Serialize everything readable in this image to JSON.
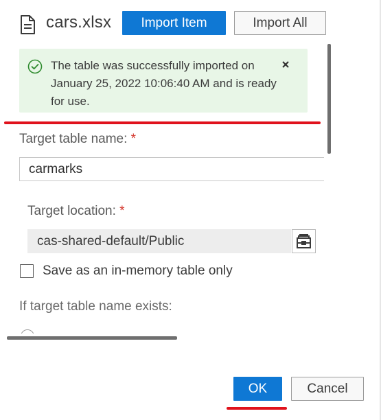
{
  "header": {
    "file_name": "cars.xlsx",
    "import_item_label": "Import Item",
    "import_all_label": "Import All"
  },
  "banner": {
    "message": "The table was successfully imported on January 25, 2022 10:06:40 AM and is ready for use.",
    "status_color": "#2e8b2e",
    "background": "#e8f6e7"
  },
  "form": {
    "target_table_label": "Target table name:",
    "target_table_value": "carmarks",
    "target_location_label": "Target location:",
    "target_location_value": "cas-shared-default/Public",
    "required_mark": "*",
    "in_memory_label": "Save as an in-memory table only",
    "in_memory_checked": false,
    "if_exists_label": "If target table name exists:"
  },
  "footer": {
    "ok_label": "OK",
    "cancel_label": "Cancel"
  },
  "colors": {
    "primary": "#0f78d4",
    "required": "#d4372d",
    "annotation_red": "#e0121c"
  },
  "icons": [
    "file-icon",
    "check-circle-icon",
    "close-icon",
    "library-browse-icon"
  ]
}
